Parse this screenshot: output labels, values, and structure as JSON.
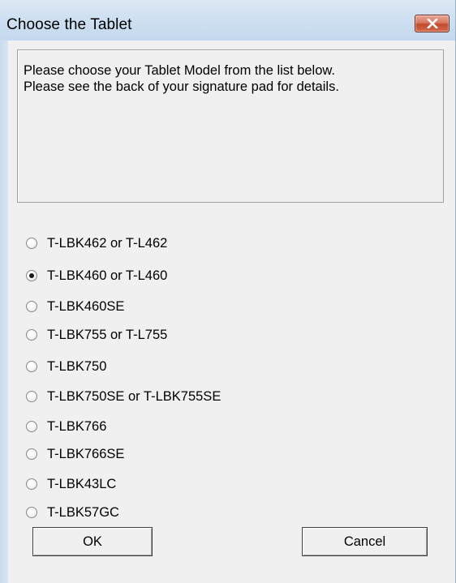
{
  "window": {
    "title": "Choose the Tablet",
    "close_icon": "close-icon"
  },
  "message": {
    "line1": "Please choose your Tablet Model from the list below.",
    "line2": "Please see the back of your signature pad for details."
  },
  "options": [
    {
      "label": "T-LBK462 or T-L462",
      "checked": false
    },
    {
      "label": "T-LBK460 or T-L460",
      "checked": true
    },
    {
      "label": "T-LBK460SE",
      "checked": false
    },
    {
      "label": "T-LBK755 or T-L755",
      "checked": false
    },
    {
      "label": "T-LBK750",
      "checked": false
    },
    {
      "label": "T-LBK750SE or T-LBK755SE",
      "checked": false
    },
    {
      "label": "T-LBK766",
      "checked": false
    },
    {
      "label": "T-LBK766SE",
      "checked": false
    },
    {
      "label": "T-LBK43LC",
      "checked": false
    },
    {
      "label": "T-LBK57GC",
      "checked": false
    }
  ],
  "buttons": {
    "ok": "OK",
    "cancel": "Cancel"
  },
  "colors": {
    "titlebar": "#cfe0f1",
    "close_button": "#c9563c",
    "dialog_background": "#f0f0f0"
  }
}
